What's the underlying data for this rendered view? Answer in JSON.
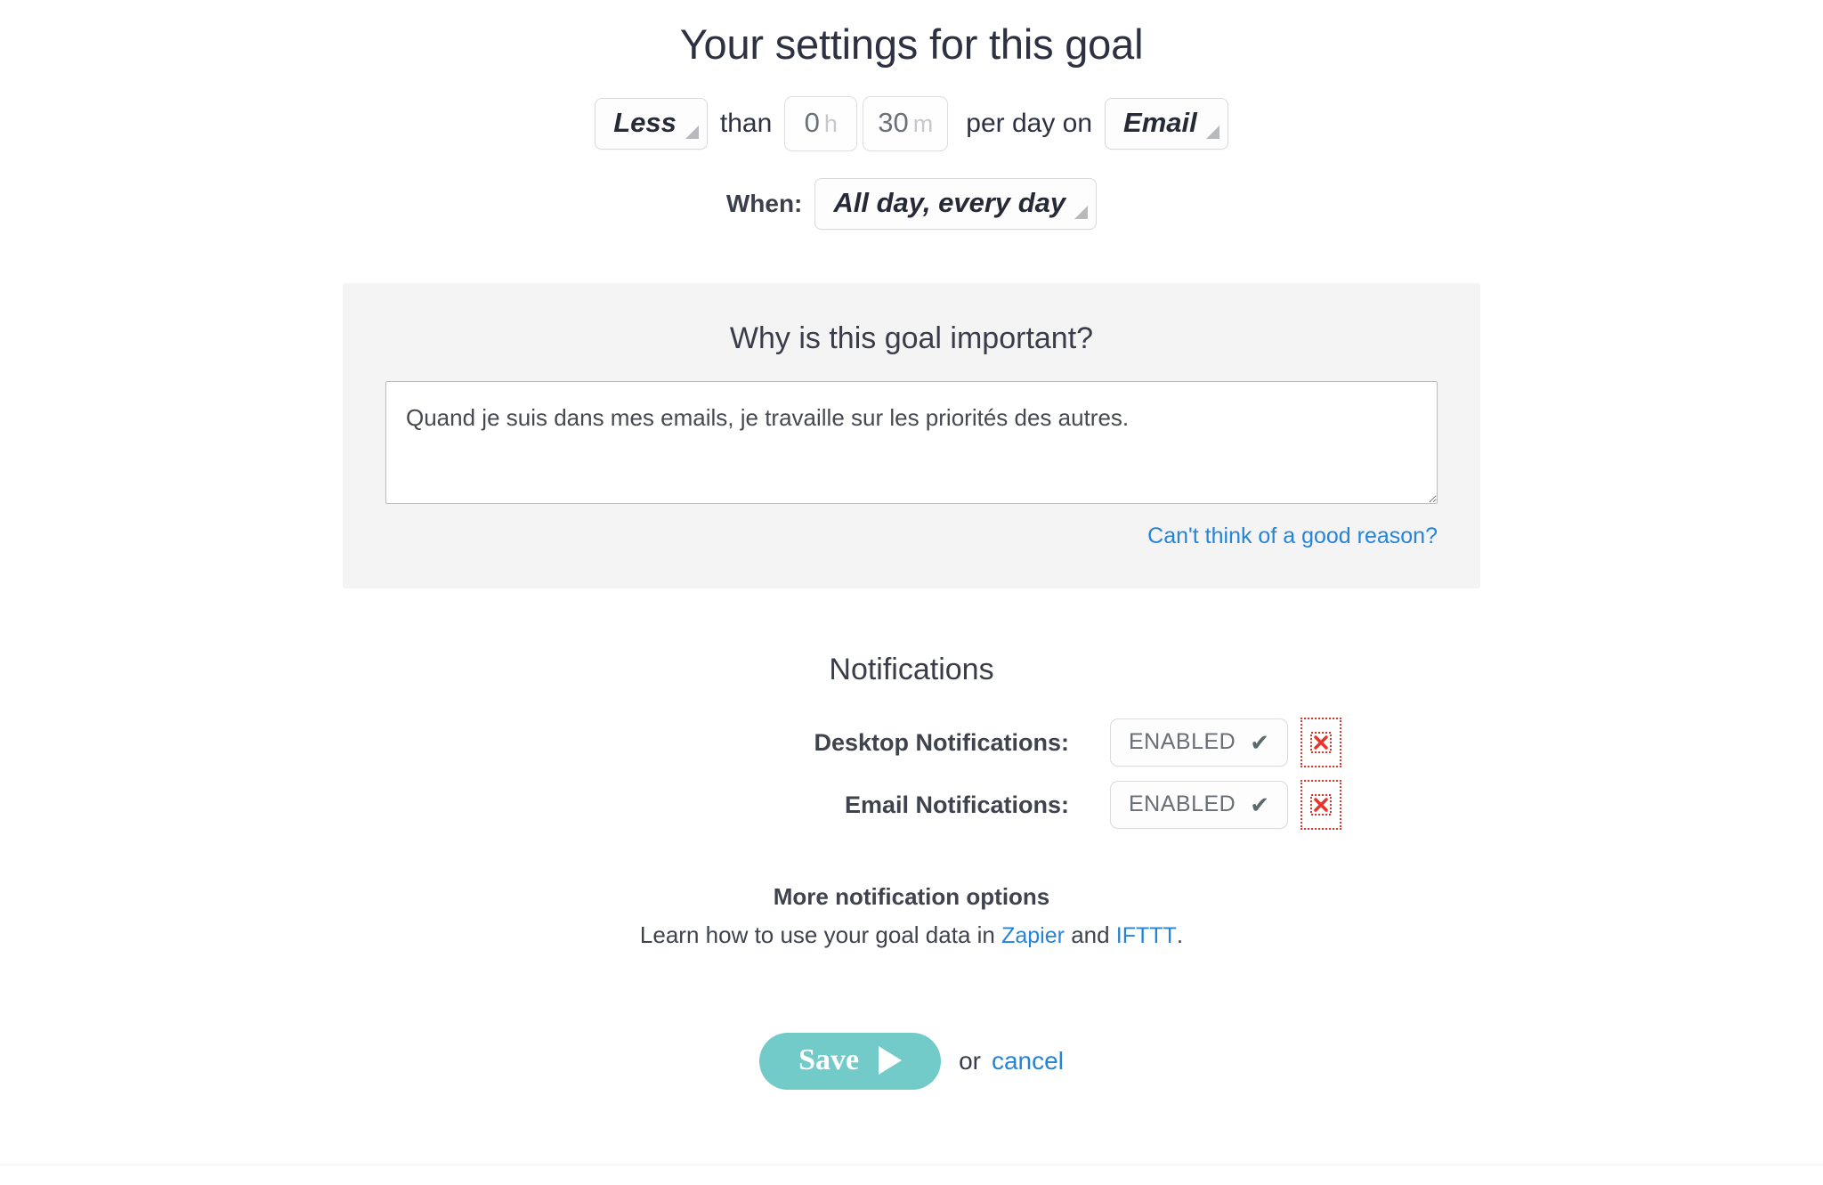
{
  "page_title": "Your settings for this goal",
  "goal_expression": {
    "comparator": {
      "value": "Less",
      "caret_icon": "caret-down-icon"
    },
    "than_text": "than",
    "hours": {
      "value": "0",
      "unit": "h",
      "placeholder": "0"
    },
    "minutes": {
      "value": "30",
      "unit": "m",
      "placeholder": "0"
    },
    "per_day_text": "per day on",
    "activity": {
      "value": "Email",
      "caret_icon": "caret-down-icon"
    }
  },
  "when_row": {
    "label": "When:",
    "schedule": {
      "value": "All day, every day",
      "caret_icon": "caret-down-icon"
    }
  },
  "why_panel": {
    "title": "Why is this goal important?",
    "reason_value": "Quand je suis dans mes emails, je travaille sur les priorités des autres.",
    "reason_placeholder": "Why is this goal important?",
    "help_link": "Can't think of a good reason?"
  },
  "notifications": {
    "title": "Notifications",
    "rows": [
      {
        "label": "Desktop Notifications:",
        "status": "ENABLED",
        "check_icon": "check-icon",
        "broken_icon": "broken-image-icon"
      },
      {
        "label": "Email Notifications:",
        "status": "ENABLED",
        "check_icon": "check-icon",
        "broken_icon": "broken-image-icon"
      }
    ],
    "more_title": "More notification options",
    "more_sub_prefix": "Learn how to use your goal data in ",
    "more_link_1": "Zapier",
    "more_sub_mid": " and ",
    "more_link_2": "IFTTT",
    "more_sub_suffix": "."
  },
  "footer_actions": {
    "save_label": "Save",
    "save_icon": "play-triangle-icon",
    "or_text": "or",
    "cancel_label": "cancel"
  },
  "colors": {
    "accent_teal": "#72cbc9",
    "link_blue": "#2684d8",
    "panel_gray": "#f4f4f5",
    "text_dark": "#2d3142",
    "broken_red": "#e8332a"
  }
}
